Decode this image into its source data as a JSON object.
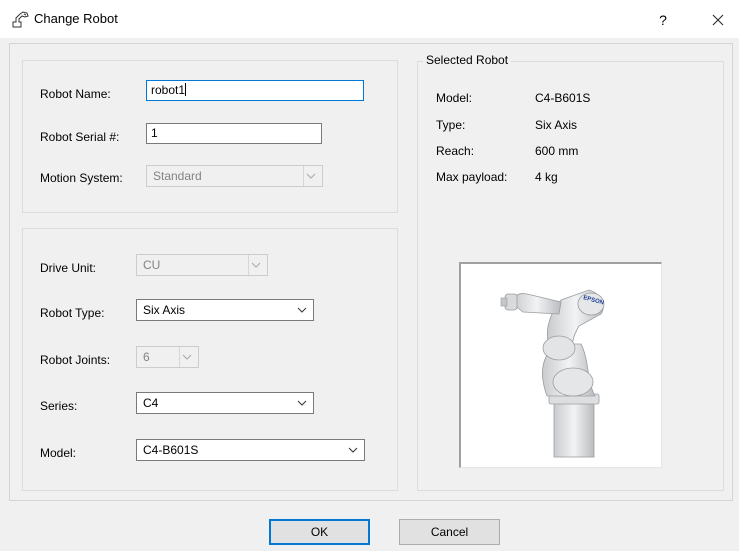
{
  "window": {
    "title": "Change Robot",
    "help_label": "?",
    "icon": "robot-arm-icon"
  },
  "robot_group": {
    "name_label": "Robot Name:",
    "name_value": "robot1",
    "serial_label": "Robot Serial #:",
    "serial_value": "1",
    "motion_label": "Motion System:",
    "motion_value": "Standard"
  },
  "drive_group": {
    "drive_label": "Drive Unit:",
    "drive_value": "CU",
    "type_label": "Robot Type:",
    "type_value": "Six Axis",
    "joints_label": "Robot Joints:",
    "joints_value": "6",
    "series_label": "Series:",
    "series_value": "C4",
    "model_label": "Model:",
    "model_value": "C4-B601S"
  },
  "selected_robot": {
    "legend": "Selected Robot",
    "rows": [
      {
        "label": "Model:",
        "value": "C4-B601S"
      },
      {
        "label": "Type:",
        "value": "Six Axis"
      },
      {
        "label": "Reach:",
        "value": "600 mm"
      },
      {
        "label": "Max payload:",
        "value": "4 kg"
      }
    ],
    "brand": "EPSON"
  },
  "buttons": {
    "ok": "OK",
    "cancel": "Cancel"
  },
  "colors": {
    "accent": "#0078d7",
    "window_bg": "#f0f0f0"
  }
}
